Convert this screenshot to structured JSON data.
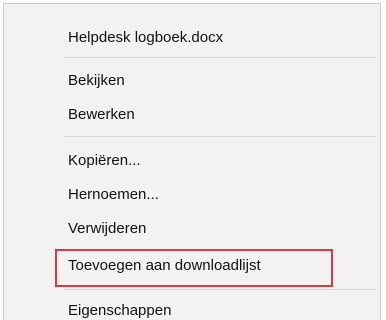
{
  "menu": {
    "title_item": "Helpdesk logboek.docx",
    "groups": [
      [
        "Bekijken",
        "Bewerken"
      ],
      [
        "Kopiëren...",
        "Hernoemen...",
        "Verwijderen",
        "Toevoegen aan downloadlijst"
      ],
      [
        "Eigenschappen"
      ]
    ],
    "highlighted_item": "Toevoegen aan downloadlijst"
  },
  "colors": {
    "menu_background": "#f2f2f2",
    "separator": "#d9d9d9",
    "highlight_border": "#d83b3b",
    "text": "#111111"
  }
}
